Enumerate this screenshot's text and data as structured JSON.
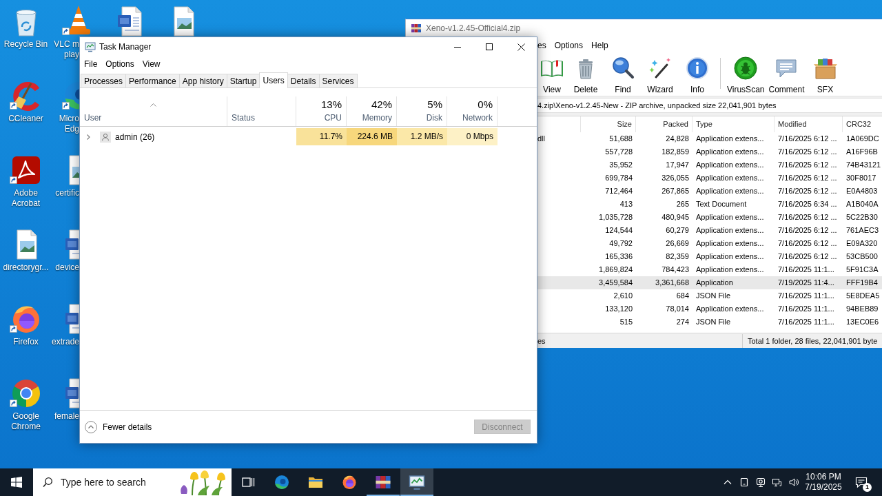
{
  "desktop": {
    "columns": [
      {
        "icons": [
          {
            "kind": "recycle-bin",
            "lines": [
              "Recycle Bin"
            ],
            "shortcut": false
          },
          {
            "kind": "ccleaner",
            "lines": [
              "CCleaner"
            ],
            "shortcut": true
          },
          {
            "kind": "acrobat",
            "lines": [
              "Adobe",
              "Acrobat"
            ],
            "shortcut": true
          },
          {
            "kind": "image-file",
            "lines": [
              "directorygr..."
            ],
            "shortcut": false
          },
          {
            "kind": "firefox",
            "lines": [
              "Firefox"
            ],
            "shortcut": true
          },
          {
            "kind": "chrome",
            "lines": [
              "Google",
              "Chrome"
            ],
            "shortcut": true
          }
        ]
      },
      {
        "icons": [
          {
            "kind": "vlc",
            "lines": [
              "VLC m",
              "play"
            ],
            "shortcut": true
          },
          {
            "kind": "edge",
            "lines": [
              "Micro",
              "Edg"
            ],
            "shortcut": true
          },
          {
            "kind": "image-file",
            "lines": [
              "certific"
            ],
            "shortcut": false
          },
          {
            "kind": "word-doc",
            "lines": [
              "device"
            ],
            "shortcut": false
          },
          {
            "kind": "word-doc",
            "lines": [
              "extrade"
            ],
            "shortcut": false
          },
          {
            "kind": "word-doc",
            "lines": [
              "female"
            ],
            "shortcut": false
          }
        ]
      },
      {
        "icons": [
          {
            "kind": "word-doc",
            "shortcut": false
          }
        ]
      },
      {
        "icons": [
          {
            "kind": "image-file",
            "shortcut": false
          }
        ]
      }
    ]
  },
  "archive_window": {
    "title": "Xeno-v1.2.45-Official4.zip",
    "menu": [
      "es",
      "Options",
      "Help"
    ],
    "toolbar": [
      {
        "kind": "view",
        "label": "View",
        "separator_before": false
      },
      {
        "kind": "delete",
        "label": "Delete",
        "separator_before": false
      },
      {
        "kind": "find",
        "label": "Find",
        "separator_before": false
      },
      {
        "kind": "wizard",
        "label": "Wizard",
        "separator_before": false
      },
      {
        "kind": "info",
        "label": "Info",
        "separator_before": false
      },
      {
        "kind": "virusscan",
        "label": "VirusScan",
        "separator_before": true
      },
      {
        "kind": "comment",
        "label": "Comment",
        "separator_before": false
      },
      {
        "kind": "sfx",
        "label": "SFX",
        "separator_before": false
      }
    ],
    "path": "4.zip\\Xeno-v1.2.45-New - ZIP archive, unpacked size 22,041,901 bytes",
    "columns": [
      "Size",
      "Packed",
      "Type",
      "Modified",
      "CRC32"
    ],
    "rows": [
      {
        "name": "dll",
        "cells": [
          "51,688",
          "24,828",
          "Application extens...",
          "7/16/2025 6:12 ...",
          "1A069DC"
        ],
        "selected": false
      },
      {
        "cells": [
          "557,728",
          "182,859",
          "Application extens...",
          "7/16/2025 6:12 ...",
          "A16F96B"
        ],
        "selected": false
      },
      {
        "cells": [
          "35,952",
          "17,947",
          "Application extens...",
          "7/16/2025 6:12 ...",
          "74B43121"
        ],
        "selected": false
      },
      {
        "cells": [
          "699,784",
          "326,055",
          "Application extens...",
          "7/16/2025 6:12 ...",
          "30F8017"
        ],
        "selected": false
      },
      {
        "cells": [
          "712,464",
          "267,865",
          "Application extens...",
          "7/16/2025 6:12 ...",
          "E0A4803"
        ],
        "selected": false
      },
      {
        "cells": [
          "413",
          "265",
          "Text Document",
          "7/16/2025 6:34 ...",
          "A1B040A"
        ],
        "selected": false
      },
      {
        "cells": [
          "1,035,728",
          "480,945",
          "Application extens...",
          "7/16/2025 6:12 ...",
          "5C22B30"
        ],
        "selected": false
      },
      {
        "cells": [
          "124,544",
          "60,279",
          "Application extens...",
          "7/16/2025 6:12 ...",
          "761AEC3"
        ],
        "selected": false
      },
      {
        "cells": [
          "49,792",
          "26,669",
          "Application extens...",
          "7/16/2025 6:12 ...",
          "E09A320"
        ],
        "selected": false
      },
      {
        "cells": [
          "165,336",
          "82,359",
          "Application extens...",
          "7/16/2025 6:12 ...",
          "53CB500"
        ],
        "selected": false
      },
      {
        "cells": [
          "1,869,824",
          "784,423",
          "Application extens...",
          "7/16/2025 11:1...",
          "5F91C3A"
        ],
        "selected": false
      },
      {
        "cells": [
          "3,459,584",
          "3,361,668",
          "Application",
          "7/19/2025 11:4...",
          "FFF19B4"
        ],
        "selected": true
      },
      {
        "cells": [
          "2,610",
          "684",
          "JSON File",
          "7/16/2025 11:1...",
          "5E8DEA5"
        ],
        "selected": false
      },
      {
        "cells": [
          "133,120",
          "78,014",
          "Application extens...",
          "7/16/2025 11:1...",
          "94BEB89"
        ],
        "selected": false
      },
      {
        "cells": [
          "515",
          "274",
          "JSON File",
          "7/16/2025 11:1...",
          "13EC0E6"
        ],
        "selected": false
      }
    ],
    "status": [
      "es",
      "Total 1 folder, 28 files, 22,041,901 byte"
    ]
  },
  "task_manager": {
    "title": "Task Manager",
    "menu": [
      "File",
      "Options",
      "View"
    ],
    "tabs": [
      {
        "label": "Processes",
        "selected": false
      },
      {
        "label": "Performance",
        "selected": false
      },
      {
        "label": "App history",
        "selected": false
      },
      {
        "label": "Startup",
        "selected": false
      },
      {
        "label": "Users",
        "selected": true
      },
      {
        "label": "Details",
        "selected": false
      },
      {
        "label": "Services",
        "selected": false
      }
    ],
    "columns": [
      {
        "label": "User",
        "sorted": true
      },
      {
        "label": "Status",
        "sorted": false
      },
      {
        "label": "CPU",
        "total": "13%",
        "sorted": false
      },
      {
        "label": "Memory",
        "total": "42%",
        "sorted": false
      },
      {
        "label": "Disk",
        "total": "5%",
        "sorted": false
      },
      {
        "label": "Network",
        "total": "0%",
        "sorted": false
      }
    ],
    "rows": [
      {
        "user": "admin (26)",
        "expanded": false,
        "metrics": [
          {
            "value": "11.7%",
            "color": "#f9e29a"
          },
          {
            "value": "224.6 MB",
            "color": "#f7d77c"
          },
          {
            "value": "1.2 MB/s",
            "color": "#fbe8a8"
          },
          {
            "value": "0 Mbps",
            "color": "#fdf1c6"
          }
        ]
      }
    ],
    "details_toggle": "Fewer details",
    "disconnect": {
      "label": "Disconnect",
      "disabled": true
    }
  },
  "taskbar": {
    "search": {
      "placeholder": "Type here to search"
    },
    "buttons": [
      {
        "kind": "task-view",
        "running": false,
        "selected": false
      },
      {
        "kind": "edge",
        "running": false,
        "selected": false
      },
      {
        "kind": "file-explorer",
        "running": false,
        "selected": false
      },
      {
        "kind": "firefox",
        "running": false,
        "selected": false
      },
      {
        "kind": "winrar",
        "running": true,
        "selected": false
      },
      {
        "kind": "task-manager",
        "running": true,
        "selected": true
      }
    ],
    "tray": [
      {
        "kind": "chevron-up"
      },
      {
        "kind": "tablet"
      },
      {
        "kind": "webcam"
      },
      {
        "kind": "network"
      },
      {
        "kind": "volume"
      }
    ],
    "clock": {
      "time": "10:06 PM",
      "date": "7/19/2025"
    },
    "notifications": {
      "count": "1"
    }
  }
}
